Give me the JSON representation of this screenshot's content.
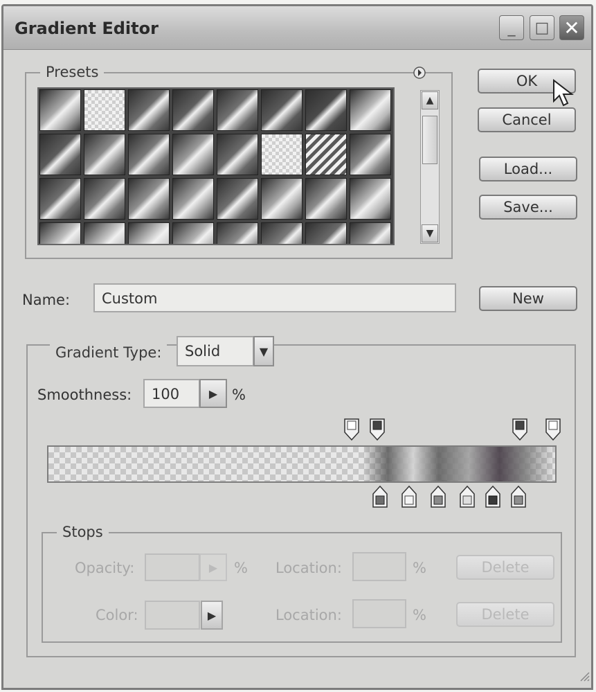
{
  "title": "Gradient Editor",
  "window_controls": {
    "minimize": "_",
    "maximize": "□",
    "close": "✕"
  },
  "presets": {
    "legend": "Presets",
    "menu_icon": "circle-arrow-icon",
    "swatch_rows": [
      [
        "#a8a8a8",
        "checker",
        "#6c6c6c",
        "#5f5f5f",
        "#707070",
        "#5a5a5a",
        "#4a4a4a",
        "#b8b8b8"
      ],
      [
        "#5c5c5c",
        "#8a8a8a",
        "#797979",
        "#9a9a9a",
        "#6a6a6a",
        "checker",
        "stripe",
        "#888888"
      ],
      [
        "#6e6e6e",
        "#7e7e7e",
        "#8e8e8e",
        "#9e9e9e",
        "#6e6e6e",
        "#a6a6a6",
        "#8c8c8c",
        "#b4b4b4"
      ],
      [
        "#bcbcbc",
        "#c4c4c4",
        "#cccccc",
        "#b0b0b0",
        "#8a8a8a",
        "#7a7a7a",
        "#6a6a6a",
        "#9c9c9c"
      ]
    ]
  },
  "buttons": {
    "ok": "OK",
    "cancel": "Cancel",
    "load": "Load...",
    "save": "Save...",
    "new": "New"
  },
  "name": {
    "label": "Name:",
    "value": "Custom"
  },
  "gradient_type": {
    "label": "Gradient Type:",
    "value": "Solid"
  },
  "smoothness": {
    "label": "Smoothness:",
    "value": "100",
    "unit": "%"
  },
  "stops": {
    "legend": "Stops",
    "opacity_label": "Opacity:",
    "opacity_unit": "%",
    "opacity_location_label": "Location:",
    "opacity_location_unit": "%",
    "opacity_delete": "Delete",
    "color_label": "Color:",
    "color_location_label": "Location:",
    "color_location_unit": "%",
    "color_delete": "Delete"
  }
}
